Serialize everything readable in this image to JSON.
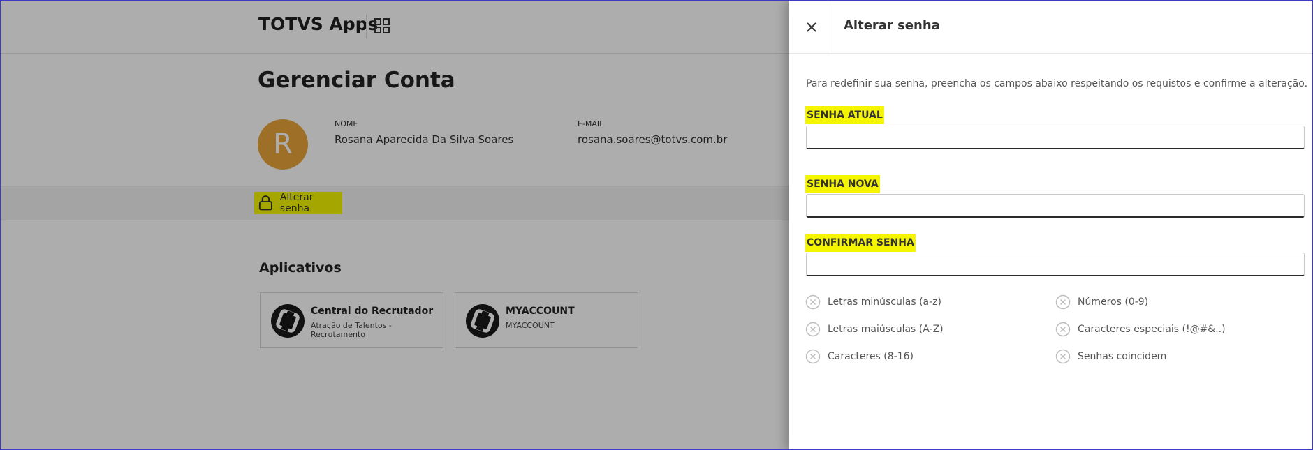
{
  "app": {
    "title": "TOTVS Apps"
  },
  "account": {
    "heading": "Gerenciar Conta",
    "avatar_initial": "R",
    "name_label": "NOME",
    "name_value": "Rosana Aparecida Da Silva Soares",
    "email_label": "E-MAIL",
    "email_value": "rosana.soares@totvs.com.br",
    "change_password_label": "Alterar senha"
  },
  "apps": {
    "title": "Aplicativos",
    "items": [
      {
        "name": "Central do Recrutador",
        "subtitle": "Atração de Talentos - Recrutamento"
      },
      {
        "name": "MYACCOUNT",
        "subtitle": "MYACCOUNT"
      }
    ]
  },
  "panel": {
    "title": "Alterar senha",
    "description": "Para redefinir sua senha, preencha os campos abaixo respeitando os requistos e confirme a alteração.",
    "fields": [
      {
        "label": "SENHA ATUAL",
        "value": ""
      },
      {
        "label": "SENHA NOVA",
        "value": ""
      },
      {
        "label": "CONFIRMAR SENHA",
        "value": ""
      }
    ],
    "requirements": [
      "Letras minúsculas (a-z)",
      "Números (0-9)",
      "Letras maiúsculas (A-Z)",
      "Caracteres especiais (!@#&..)",
      "Caracteres (8-16)",
      "Senhas coincidem"
    ]
  },
  "icons": {
    "grid": "apps-grid-icon",
    "lock": "lock-icon",
    "close": "close-icon",
    "requirement": "x-circle-icon",
    "app_logo": "totvs-logo-icon"
  },
  "colors": {
    "highlight": "#f5f500",
    "avatar": "#e8a43a",
    "overlay": "rgba(0,0,0,0.32)"
  }
}
